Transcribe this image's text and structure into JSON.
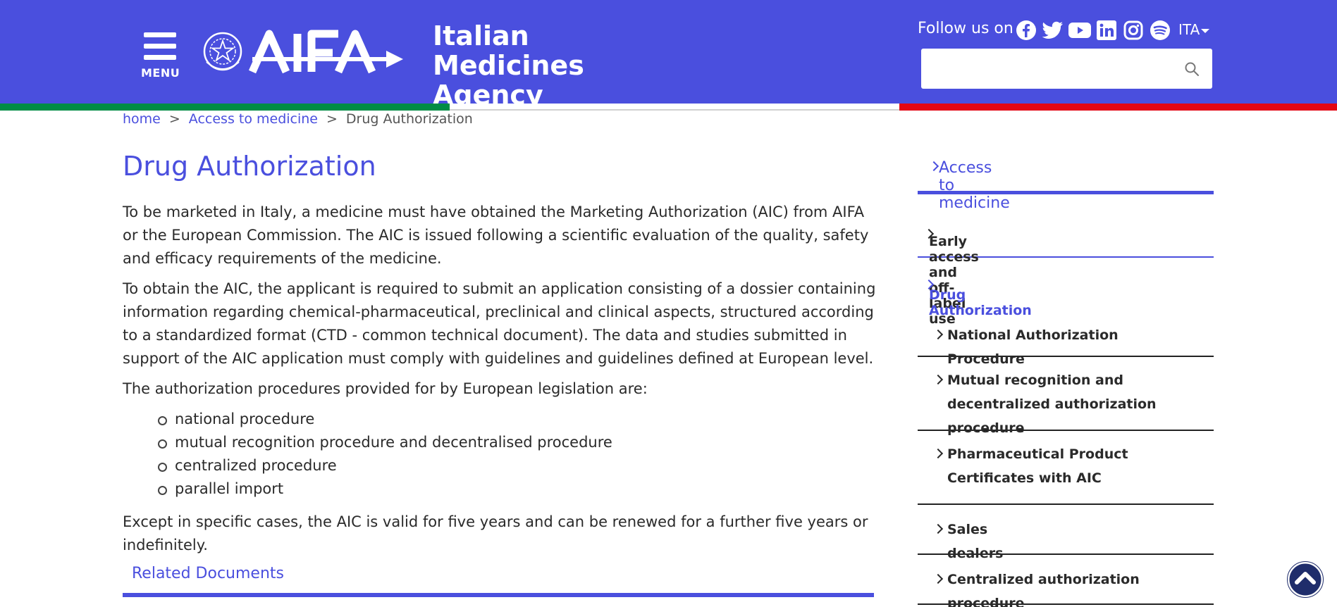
{
  "header": {
    "menu_label": "MENU",
    "agency_name": "Italian Medicines Agency",
    "follow_label": "Follow us on",
    "socials": [
      "facebook-icon",
      "twitter-icon",
      "youtube-icon",
      "linkedin-icon",
      "instagram-icon",
      "spotify-icon"
    ],
    "language": "ITA",
    "search_placeholder": ""
  },
  "colors": {
    "primary": "#4a4fde",
    "flag_green": "#008c45",
    "flag_white": "#ffffff",
    "flag_red": "#e30613",
    "scroll_button": "#1f2d6b"
  },
  "breadcrumb": {
    "home": "home",
    "level1": "Access to medicine",
    "current": "Drug Authorization",
    "separator": ">"
  },
  "main": {
    "title": "Drug Authorization",
    "paragraph1": "To be marketed in Italy, a medicine must have obtained the Marketing Authorization (AIC) from AIFA or the European Commission. The AIC is issued following a scientific evaluation of the quality, safety and efficacy requirements of the medicine.",
    "paragraph2": "To obtain the AIC, the applicant is required to submit an application consisting of a dossier containing information regarding chemical-pharmaceutical, preclinical and clinical aspects, structured according to a standardized format (CTD - common technical document). The data and studies submitted in support of the AIC application must comply with guidelines and guidelines defined at European level.",
    "paragraph3": "The authorization procedures provided for by European legislation are:",
    "procedures": [
      "national procedure",
      "mutual recognition procedure and decentralised procedure",
      "centralized procedure",
      "parallel import"
    ],
    "paragraph4": "Except in specific cases, the AIC is valid for five years and can be renewed for a further five years or indefinitely.",
    "related_documents": "Related Documents"
  },
  "sidebar": {
    "header": "Access to medicine",
    "early_access": "Early access and off-label use",
    "drug_authorization": "Drug Authorization",
    "subitems": [
      "National Authorization Procedure",
      "Mutual recognition and decentralized authorization procedure",
      "Pharmaceutical Product Certificates with AIC",
      "Sales dealers",
      "Centralized authorization procedure"
    ]
  }
}
